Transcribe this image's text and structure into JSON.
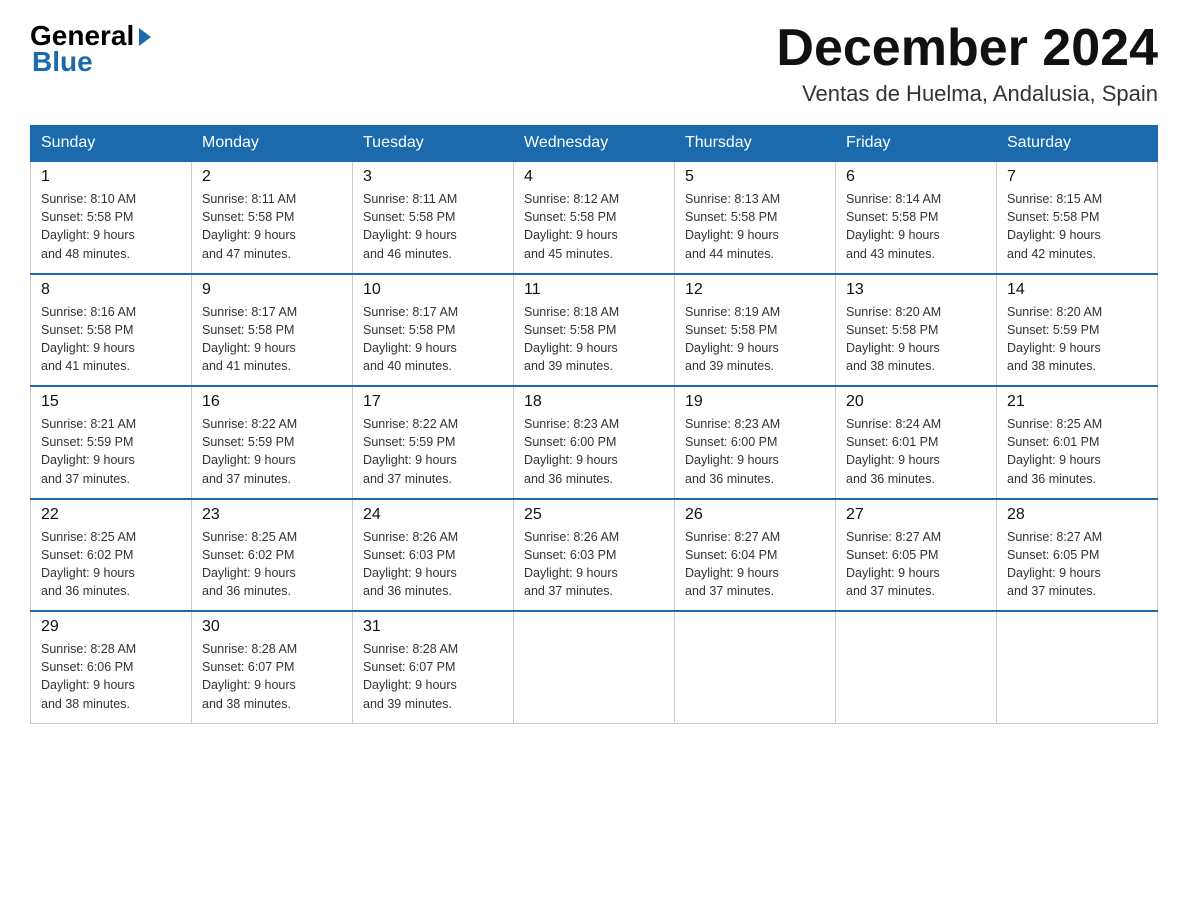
{
  "logo": {
    "general": "General",
    "blue": "Blue"
  },
  "header": {
    "month_year": "December 2024",
    "location": "Ventas de Huelma, Andalusia, Spain"
  },
  "days_of_week": [
    "Sunday",
    "Monday",
    "Tuesday",
    "Wednesday",
    "Thursday",
    "Friday",
    "Saturday"
  ],
  "weeks": [
    [
      {
        "day": "1",
        "sunrise": "8:10 AM",
        "sunset": "5:58 PM",
        "daylight": "9 hours and 48 minutes."
      },
      {
        "day": "2",
        "sunrise": "8:11 AM",
        "sunset": "5:58 PM",
        "daylight": "9 hours and 47 minutes."
      },
      {
        "day": "3",
        "sunrise": "8:11 AM",
        "sunset": "5:58 PM",
        "daylight": "9 hours and 46 minutes."
      },
      {
        "day": "4",
        "sunrise": "8:12 AM",
        "sunset": "5:58 PM",
        "daylight": "9 hours and 45 minutes."
      },
      {
        "day": "5",
        "sunrise": "8:13 AM",
        "sunset": "5:58 PM",
        "daylight": "9 hours and 44 minutes."
      },
      {
        "day": "6",
        "sunrise": "8:14 AM",
        "sunset": "5:58 PM",
        "daylight": "9 hours and 43 minutes."
      },
      {
        "day": "7",
        "sunrise": "8:15 AM",
        "sunset": "5:58 PM",
        "daylight": "9 hours and 42 minutes."
      }
    ],
    [
      {
        "day": "8",
        "sunrise": "8:16 AM",
        "sunset": "5:58 PM",
        "daylight": "9 hours and 41 minutes."
      },
      {
        "day": "9",
        "sunrise": "8:17 AM",
        "sunset": "5:58 PM",
        "daylight": "9 hours and 41 minutes."
      },
      {
        "day": "10",
        "sunrise": "8:17 AM",
        "sunset": "5:58 PM",
        "daylight": "9 hours and 40 minutes."
      },
      {
        "day": "11",
        "sunrise": "8:18 AM",
        "sunset": "5:58 PM",
        "daylight": "9 hours and 39 minutes."
      },
      {
        "day": "12",
        "sunrise": "8:19 AM",
        "sunset": "5:58 PM",
        "daylight": "9 hours and 39 minutes."
      },
      {
        "day": "13",
        "sunrise": "8:20 AM",
        "sunset": "5:58 PM",
        "daylight": "9 hours and 38 minutes."
      },
      {
        "day": "14",
        "sunrise": "8:20 AM",
        "sunset": "5:59 PM",
        "daylight": "9 hours and 38 minutes."
      }
    ],
    [
      {
        "day": "15",
        "sunrise": "8:21 AM",
        "sunset": "5:59 PM",
        "daylight": "9 hours and 37 minutes."
      },
      {
        "day": "16",
        "sunrise": "8:22 AM",
        "sunset": "5:59 PM",
        "daylight": "9 hours and 37 minutes."
      },
      {
        "day": "17",
        "sunrise": "8:22 AM",
        "sunset": "5:59 PM",
        "daylight": "9 hours and 37 minutes."
      },
      {
        "day": "18",
        "sunrise": "8:23 AM",
        "sunset": "6:00 PM",
        "daylight": "9 hours and 36 minutes."
      },
      {
        "day": "19",
        "sunrise": "8:23 AM",
        "sunset": "6:00 PM",
        "daylight": "9 hours and 36 minutes."
      },
      {
        "day": "20",
        "sunrise": "8:24 AM",
        "sunset": "6:01 PM",
        "daylight": "9 hours and 36 minutes."
      },
      {
        "day": "21",
        "sunrise": "8:25 AM",
        "sunset": "6:01 PM",
        "daylight": "9 hours and 36 minutes."
      }
    ],
    [
      {
        "day": "22",
        "sunrise": "8:25 AM",
        "sunset": "6:02 PM",
        "daylight": "9 hours and 36 minutes."
      },
      {
        "day": "23",
        "sunrise": "8:25 AM",
        "sunset": "6:02 PM",
        "daylight": "9 hours and 36 minutes."
      },
      {
        "day": "24",
        "sunrise": "8:26 AM",
        "sunset": "6:03 PM",
        "daylight": "9 hours and 36 minutes."
      },
      {
        "day": "25",
        "sunrise": "8:26 AM",
        "sunset": "6:03 PM",
        "daylight": "9 hours and 37 minutes."
      },
      {
        "day": "26",
        "sunrise": "8:27 AM",
        "sunset": "6:04 PM",
        "daylight": "9 hours and 37 minutes."
      },
      {
        "day": "27",
        "sunrise": "8:27 AM",
        "sunset": "6:05 PM",
        "daylight": "9 hours and 37 minutes."
      },
      {
        "day": "28",
        "sunrise": "8:27 AM",
        "sunset": "6:05 PM",
        "daylight": "9 hours and 37 minutes."
      }
    ],
    [
      {
        "day": "29",
        "sunrise": "8:28 AM",
        "sunset": "6:06 PM",
        "daylight": "9 hours and 38 minutes."
      },
      {
        "day": "30",
        "sunrise": "8:28 AM",
        "sunset": "6:07 PM",
        "daylight": "9 hours and 38 minutes."
      },
      {
        "day": "31",
        "sunrise": "8:28 AM",
        "sunset": "6:07 PM",
        "daylight": "9 hours and 39 minutes."
      },
      null,
      null,
      null,
      null
    ]
  ],
  "labels": {
    "sunrise": "Sunrise:",
    "sunset": "Sunset:",
    "daylight": "Daylight:"
  },
  "colors": {
    "header_bg": "#1a6aad",
    "header_text": "#ffffff",
    "border_top": "#1a6aad"
  }
}
